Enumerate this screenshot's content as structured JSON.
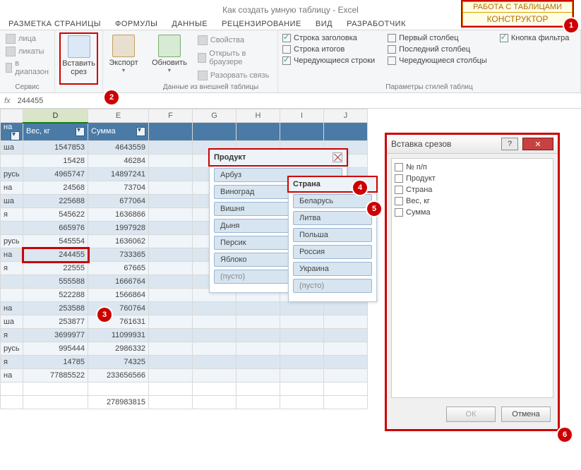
{
  "title": "Как создать умную таблицу - Excel",
  "context_tab_top": "РАБОТА С ТАБЛИЦАМИ",
  "context_tab_bottom": "КОНСТРУКТОР",
  "tabs": {
    "t1": "РАЗМЕТКА СТРАНИЦЫ",
    "t2": "ФОРМУЛЫ",
    "t3": "ДАННЫЕ",
    "t4": "РЕЦЕНЗИРОВАНИЕ",
    "t5": "ВИД",
    "t6": "РАЗРАБОТЧИК"
  },
  "ribbon": {
    "g1": {
      "i1": "лица",
      "i2": "ликаты",
      "i3": "в диапазон",
      "label": "Сервис"
    },
    "g2": {
      "btn": "Вставить\nсрез"
    },
    "g3": {
      "btn": "Экспорт"
    },
    "g4": {
      "btn": "Обновить",
      "i1": "Свойства",
      "i2": "Открыть в браузере",
      "i3": "Разорвать связь",
      "label": "Данные из внешней таблицы"
    },
    "g5": {
      "c1": "Строка заголовка",
      "c2": "Строка итогов",
      "c3": "Чередующиеся строки",
      "c4": "Первый столбец",
      "c5": "Последний столбец",
      "c6": "Чередующиеся столбцы",
      "c7": "Кнопка фильтра",
      "label": "Параметры стилей таблиц"
    }
  },
  "fx": {
    "fx_label": "fx",
    "value": "244455"
  },
  "cols": [
    "",
    "D",
    "E",
    "F",
    "G",
    "H",
    "I",
    "J"
  ],
  "headers": {
    "c1": "на",
    "c2": "Вес,  кг",
    "c3": "Сумма"
  },
  "rows": [
    {
      "a": "ша",
      "d": "1547853",
      "e": "4643559"
    },
    {
      "a": "",
      "d": "15428",
      "e": "46284"
    },
    {
      "a": "русь",
      "d": "4965747",
      "e": "14897241"
    },
    {
      "a": "на",
      "d": "24568",
      "e": "73704"
    },
    {
      "a": "ша",
      "d": "225688",
      "e": "677064"
    },
    {
      "a": "я",
      "d": "545622",
      "e": "1636866"
    },
    {
      "a": "",
      "d": "665976",
      "e": "1997928"
    },
    {
      "a": "русь",
      "d": "545554",
      "e": "1636062"
    },
    {
      "a": "на",
      "d": "244455",
      "e": "733365"
    },
    {
      "a": "я",
      "d": "22555",
      "e": "67665"
    },
    {
      "a": "",
      "d": "555588",
      "e": "1666764"
    },
    {
      "a": "",
      "d": "522288",
      "e": "1566864"
    },
    {
      "a": "на",
      "d": "253588",
      "e": "760764"
    },
    {
      "a": "ша",
      "d": "253877",
      "e": "761631"
    },
    {
      "a": "я",
      "d": "3699977",
      "e": "11099931"
    },
    {
      "a": "русь",
      "d": "995444",
      "e": "2986332"
    },
    {
      "a": "я",
      "d": "14785",
      "e": "74325"
    },
    {
      "a": "на",
      "d": "77885522",
      "e": "233656566"
    },
    {
      "a": "",
      "d": "",
      "e": ""
    },
    {
      "a": "",
      "d": "",
      "e": "278983815"
    }
  ],
  "slicer1": {
    "title": "Продукт",
    "items": [
      "Арбуз",
      "Виноград",
      "Вишня",
      "Дыня",
      "Персик",
      "Яблоко",
      "(пусто)"
    ]
  },
  "slicer2": {
    "title": "Страна",
    "items": [
      "Беларусь",
      "Литва",
      "Польша",
      "Россия",
      "Украина",
      "(пусто)"
    ]
  },
  "dialog": {
    "title": "Вставка срезов",
    "fields": [
      "№ п/п",
      "Продукт",
      "Страна",
      "Вес,  кг",
      "Сумма"
    ],
    "ok": "ОК",
    "cancel": "Отмена"
  }
}
